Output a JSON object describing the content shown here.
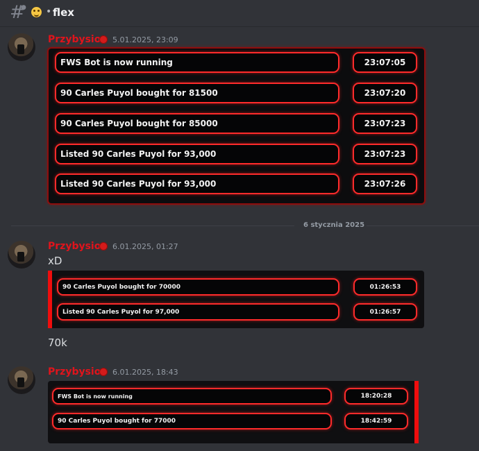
{
  "channel": {
    "name": "flex",
    "separator": "•",
    "hash_icon": "hash-icon",
    "emoji_icon": "grinning-face-emoji"
  },
  "messages": [
    {
      "author": "Przybysio",
      "timestamp": "5.01.2025, 23:09",
      "embed_rows": [
        {
          "text": "FWS Bot is now running",
          "time": "23:07:05"
        },
        {
          "text": "90 Carles Puyol bought for 81500",
          "time": "23:07:20"
        },
        {
          "text": "90 Carles Puyol bought for 85000",
          "time": "23:07:23"
        },
        {
          "text": "Listed 90 Carles Puyol for 93,000",
          "time": "23:07:23"
        },
        {
          "text": "Listed 90 Carles Puyol for 93,000",
          "time": "23:07:26"
        }
      ]
    },
    {
      "author": "Przybysio",
      "timestamp": "6.01.2025, 01:27",
      "text_before": "xD",
      "embed_rows": [
        {
          "text": "90 Carles Puyol bought for 70000",
          "time": "01:26:53"
        },
        {
          "text": "Listed 90 Carles Puyol for 97,000",
          "time": "01:26:57"
        }
      ],
      "text_after": "70k"
    },
    {
      "author": "Przybysio",
      "timestamp": "6.01.2025, 18:43",
      "embed_rows": [
        {
          "text": "FWS Bot is now running",
          "time": "18:20:28"
        },
        {
          "text": "90 Carles Puyol bought for 77000",
          "time": "18:42:59"
        }
      ]
    }
  ],
  "date_divider": "6 stycznia 2025",
  "colors": {
    "accent_red": "#ff2b2b",
    "username_red": "#e0141c",
    "background": "#313338"
  }
}
